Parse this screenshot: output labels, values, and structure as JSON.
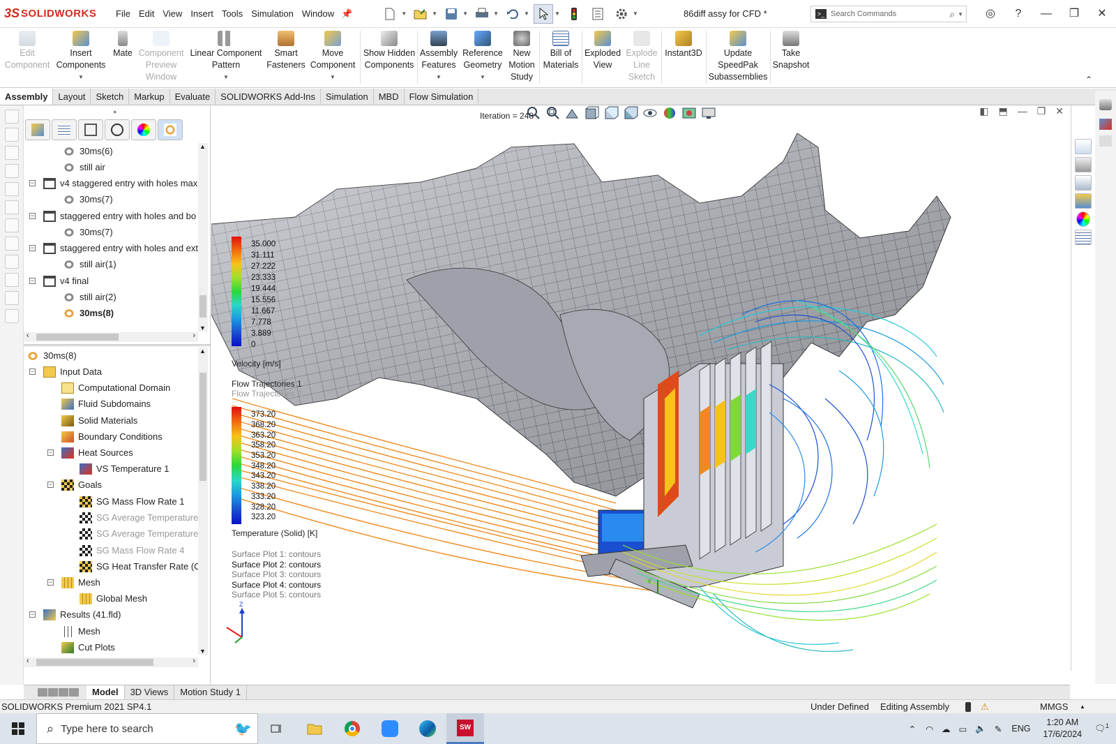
{
  "app": {
    "brand": "SOLIDWORKS",
    "brand_mark": "3S",
    "document_title": "86diff assy for CFD *",
    "menu": [
      "File",
      "Edit",
      "View",
      "Insert",
      "Tools",
      "Simulation",
      "Window"
    ],
    "search_placeholder": "Search Commands"
  },
  "commands": [
    {
      "label": "Edit Component",
      "disabled": true
    },
    {
      "label": "Insert Components",
      "disabled": false
    },
    {
      "label": "Mate",
      "disabled": false
    },
    {
      "label": "Component Preview Window",
      "disabled": true
    },
    {
      "label": "Linear Component Pattern",
      "disabled": false
    },
    {
      "label": "Smart Fasteners",
      "disabled": false
    },
    {
      "label": "Move Component",
      "disabled": false
    },
    {
      "label": "Show Hidden Components",
      "disabled": false
    },
    {
      "label": "Assembly Features",
      "disabled": false
    },
    {
      "label": "Reference Geometry",
      "disabled": false
    },
    {
      "label": "New Motion Study",
      "disabled": false
    },
    {
      "label": "Bill of Materials",
      "disabled": false
    },
    {
      "label": "Exploded View",
      "disabled": false
    },
    {
      "label": "Explode Line Sketch",
      "disabled": true
    },
    {
      "label": "Instant3D",
      "disabled": false
    },
    {
      "label": "Update SpeedPak Subassemblies",
      "disabled": false
    },
    {
      "label": "Take Snapshot",
      "disabled": false
    }
  ],
  "tabs": [
    "Assembly",
    "Layout",
    "Sketch",
    "Markup",
    "Evaluate",
    "SOLIDWORKS Add-Ins",
    "Simulation",
    "MBD",
    "Flow Simulation"
  ],
  "active_tab": "Assembly",
  "config_tree": [
    {
      "label": "30ms(6)",
      "indent": 2
    },
    {
      "label": "still air",
      "indent": 2
    },
    {
      "label": "v4 staggered entry with holes max",
      "indent": 1
    },
    {
      "label": "30ms(7)",
      "indent": 2
    },
    {
      "label": "staggered entry with holes and bo",
      "indent": 1
    },
    {
      "label": "30ms(7)",
      "indent": 2
    },
    {
      "label": "staggered entry with holes and ext",
      "indent": 1
    },
    {
      "label": "still air(1)",
      "indent": 2
    },
    {
      "label": "v4 final",
      "indent": 1
    },
    {
      "label": "still air(2)",
      "indent": 2
    },
    {
      "label": "30ms(8)",
      "indent": 2,
      "bold": true
    }
  ],
  "analysis_tree": [
    {
      "label": "30ms(8)",
      "indent": 0
    },
    {
      "label": "Input Data",
      "indent": 1
    },
    {
      "label": "Computational Domain",
      "indent": 2
    },
    {
      "label": "Fluid Subdomains",
      "indent": 2
    },
    {
      "label": "Solid Materials",
      "indent": 2
    },
    {
      "label": "Boundary Conditions",
      "indent": 2
    },
    {
      "label": "Heat Sources",
      "indent": 2
    },
    {
      "label": "VS Temperature 1",
      "indent": 3
    },
    {
      "label": "Goals",
      "indent": 2
    },
    {
      "label": "SG Mass Flow Rate 1",
      "indent": 3
    },
    {
      "label": "SG Average Temperature",
      "indent": 3,
      "grey": true
    },
    {
      "label": "SG Average Temperature",
      "indent": 3,
      "grey": true
    },
    {
      "label": "SG Mass Flow Rate 4",
      "indent": 3,
      "grey": true
    },
    {
      "label": "SG Heat Transfer Rate (Co",
      "indent": 3
    },
    {
      "label": "Mesh",
      "indent": 2
    },
    {
      "label": "Global Mesh",
      "indent": 3
    },
    {
      "label": "Results (41.fld)",
      "indent": 1
    },
    {
      "label": "Mesh",
      "indent": 2
    },
    {
      "label": "Cut Plots",
      "indent": 2
    }
  ],
  "graphics": {
    "iteration": "Iteration = 248",
    "velocity_legend": {
      "title": "Velocity [m/s]",
      "values": [
        "35.000",
        "31.111",
        "27.222",
        "23.333",
        "19.444",
        "15.556",
        "11.667",
        "7.778",
        "3.889",
        "0"
      ]
    },
    "flow_trajectories": [
      "Flow Trajectories 1",
      "Flow Trajectories 2"
    ],
    "temperature_legend": {
      "title": "Temperature (Solid) [K]",
      "values": [
        "373.20",
        "368.20",
        "363.20",
        "358.20",
        "353.20",
        "348.20",
        "343.20",
        "338.20",
        "333.20",
        "328.20",
        "323.20"
      ]
    },
    "surface_plots": [
      {
        "label": "Surface Plot 1: contours",
        "active": false
      },
      {
        "label": "Surface Plot 2: contours",
        "active": true
      },
      {
        "label": "Surface Plot 3: contours",
        "active": false
      },
      {
        "label": "Surface Plot 4: contours",
        "active": true
      },
      {
        "label": "Surface Plot 5: contours",
        "active": false
      }
    ],
    "triad": {
      "z": "Z",
      "y": "Y"
    }
  },
  "bottom_tabs": [
    "Model",
    "3D Views",
    "Motion Study 1"
  ],
  "status": {
    "product": "SOLIDWORKS Premium 2021 SP4.1",
    "state1": "Under Defined",
    "state2": "Editing Assembly",
    "units": "MMGS"
  },
  "taskbar": {
    "search_placeholder": "Type here to search",
    "language": "ENG",
    "time": "1:20 AM",
    "date": "17/6/2024",
    "notifications": "1"
  }
}
